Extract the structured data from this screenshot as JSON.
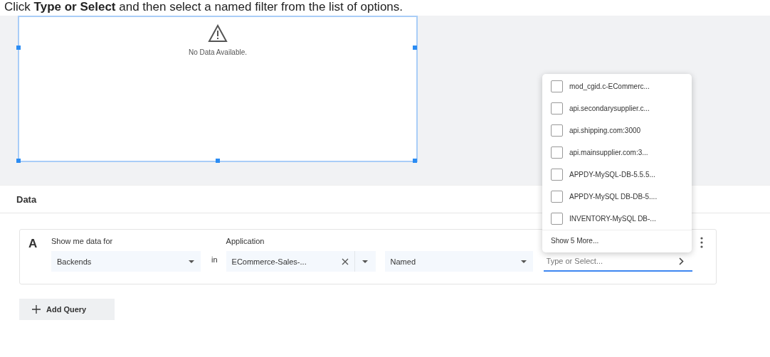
{
  "instruction": "Click **Type or Select** and then select a named filter from the list of options.",
  "widget": {
    "message": "No Data Available.",
    "selected": true
  },
  "data_panel": {
    "title": "Data",
    "query": {
      "letter": "A",
      "show_label": "Show me data for",
      "entity": "Backends",
      "in_label": "in",
      "scope_label": "Application",
      "scope_value": "ECommerce-Sales-...",
      "filter": "Named",
      "search": {
        "placeholder": "Type or Select...",
        "focused": true
      }
    },
    "add_query": "Add Query"
  },
  "dropdown": {
    "options": [
      {
        "label": "mod_cgid.c-ECommerc...",
        "checked": false
      },
      {
        "label": "api.secondarysupplier.c...",
        "checked": false
      },
      {
        "label": "api.shipping.com:3000",
        "checked": false
      },
      {
        "label": "api.mainsupplier.com:3...",
        "checked": false
      },
      {
        "label": "APPDY-MySQL-DB-5.5.5...",
        "checked": false
      },
      {
        "label": "APPDY-MySQL DB-DB-5....",
        "checked": false
      },
      {
        "label": "INVENTORY-MySQL DB-...",
        "checked": false
      }
    ],
    "more": "Show 5 More..."
  }
}
